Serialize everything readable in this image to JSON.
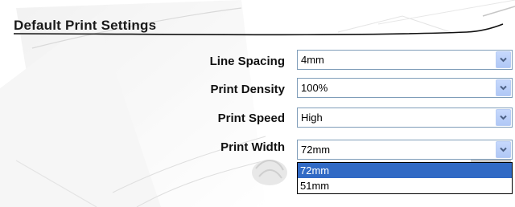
{
  "section": {
    "title": "Default Print Settings"
  },
  "settings": [
    {
      "label": "Line Spacing",
      "value": "4mm"
    },
    {
      "label": "Print Density",
      "value": "100%"
    },
    {
      "label": "Print Speed",
      "value": "High"
    },
    {
      "label": "Print Width",
      "value": "72mm"
    }
  ],
  "print_width_dropdown": {
    "options": [
      "72mm",
      "51mm"
    ],
    "highlighted": "72mm"
  },
  "colors": {
    "select_border": "#7f9db9",
    "dropdown_button": "#c6d8fc",
    "highlight": "#316ac5"
  }
}
